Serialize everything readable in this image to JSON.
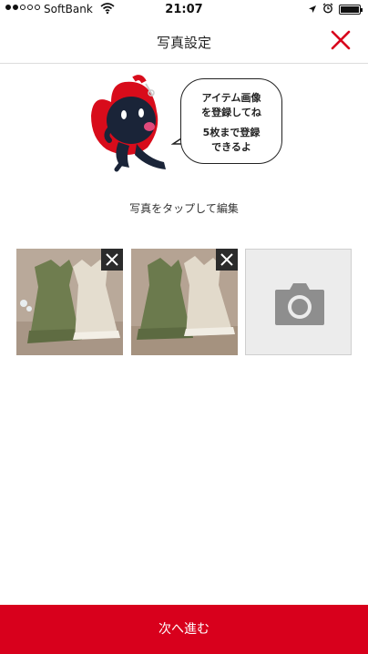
{
  "status_bar": {
    "carrier": "SoftBank",
    "time": "21:07",
    "signal_icon": "signal-dots-icon",
    "wifi_icon": "wifi-icon",
    "location_icon": "location-arrow-icon",
    "alarm_icon": "alarm-icon",
    "battery_icon": "battery-icon"
  },
  "header": {
    "title": "写真設定",
    "close_icon": "close-icon",
    "accent_color": "#d8001c"
  },
  "mascot": {
    "icon": "mascot-icon",
    "bubble_line1": "アイテム画像\nを登録してね",
    "bubble_line2": "5枚まで登録\nできるよ"
  },
  "hint": "写真をタップして編集",
  "photos": [
    {
      "name": "photo-1",
      "delete_icon": "close-icon"
    },
    {
      "name": "photo-2",
      "delete_icon": "close-icon"
    }
  ],
  "add_photo": {
    "icon": "camera-icon"
  },
  "footer": {
    "next_label": "次へ進む",
    "color": "#d8001c"
  }
}
